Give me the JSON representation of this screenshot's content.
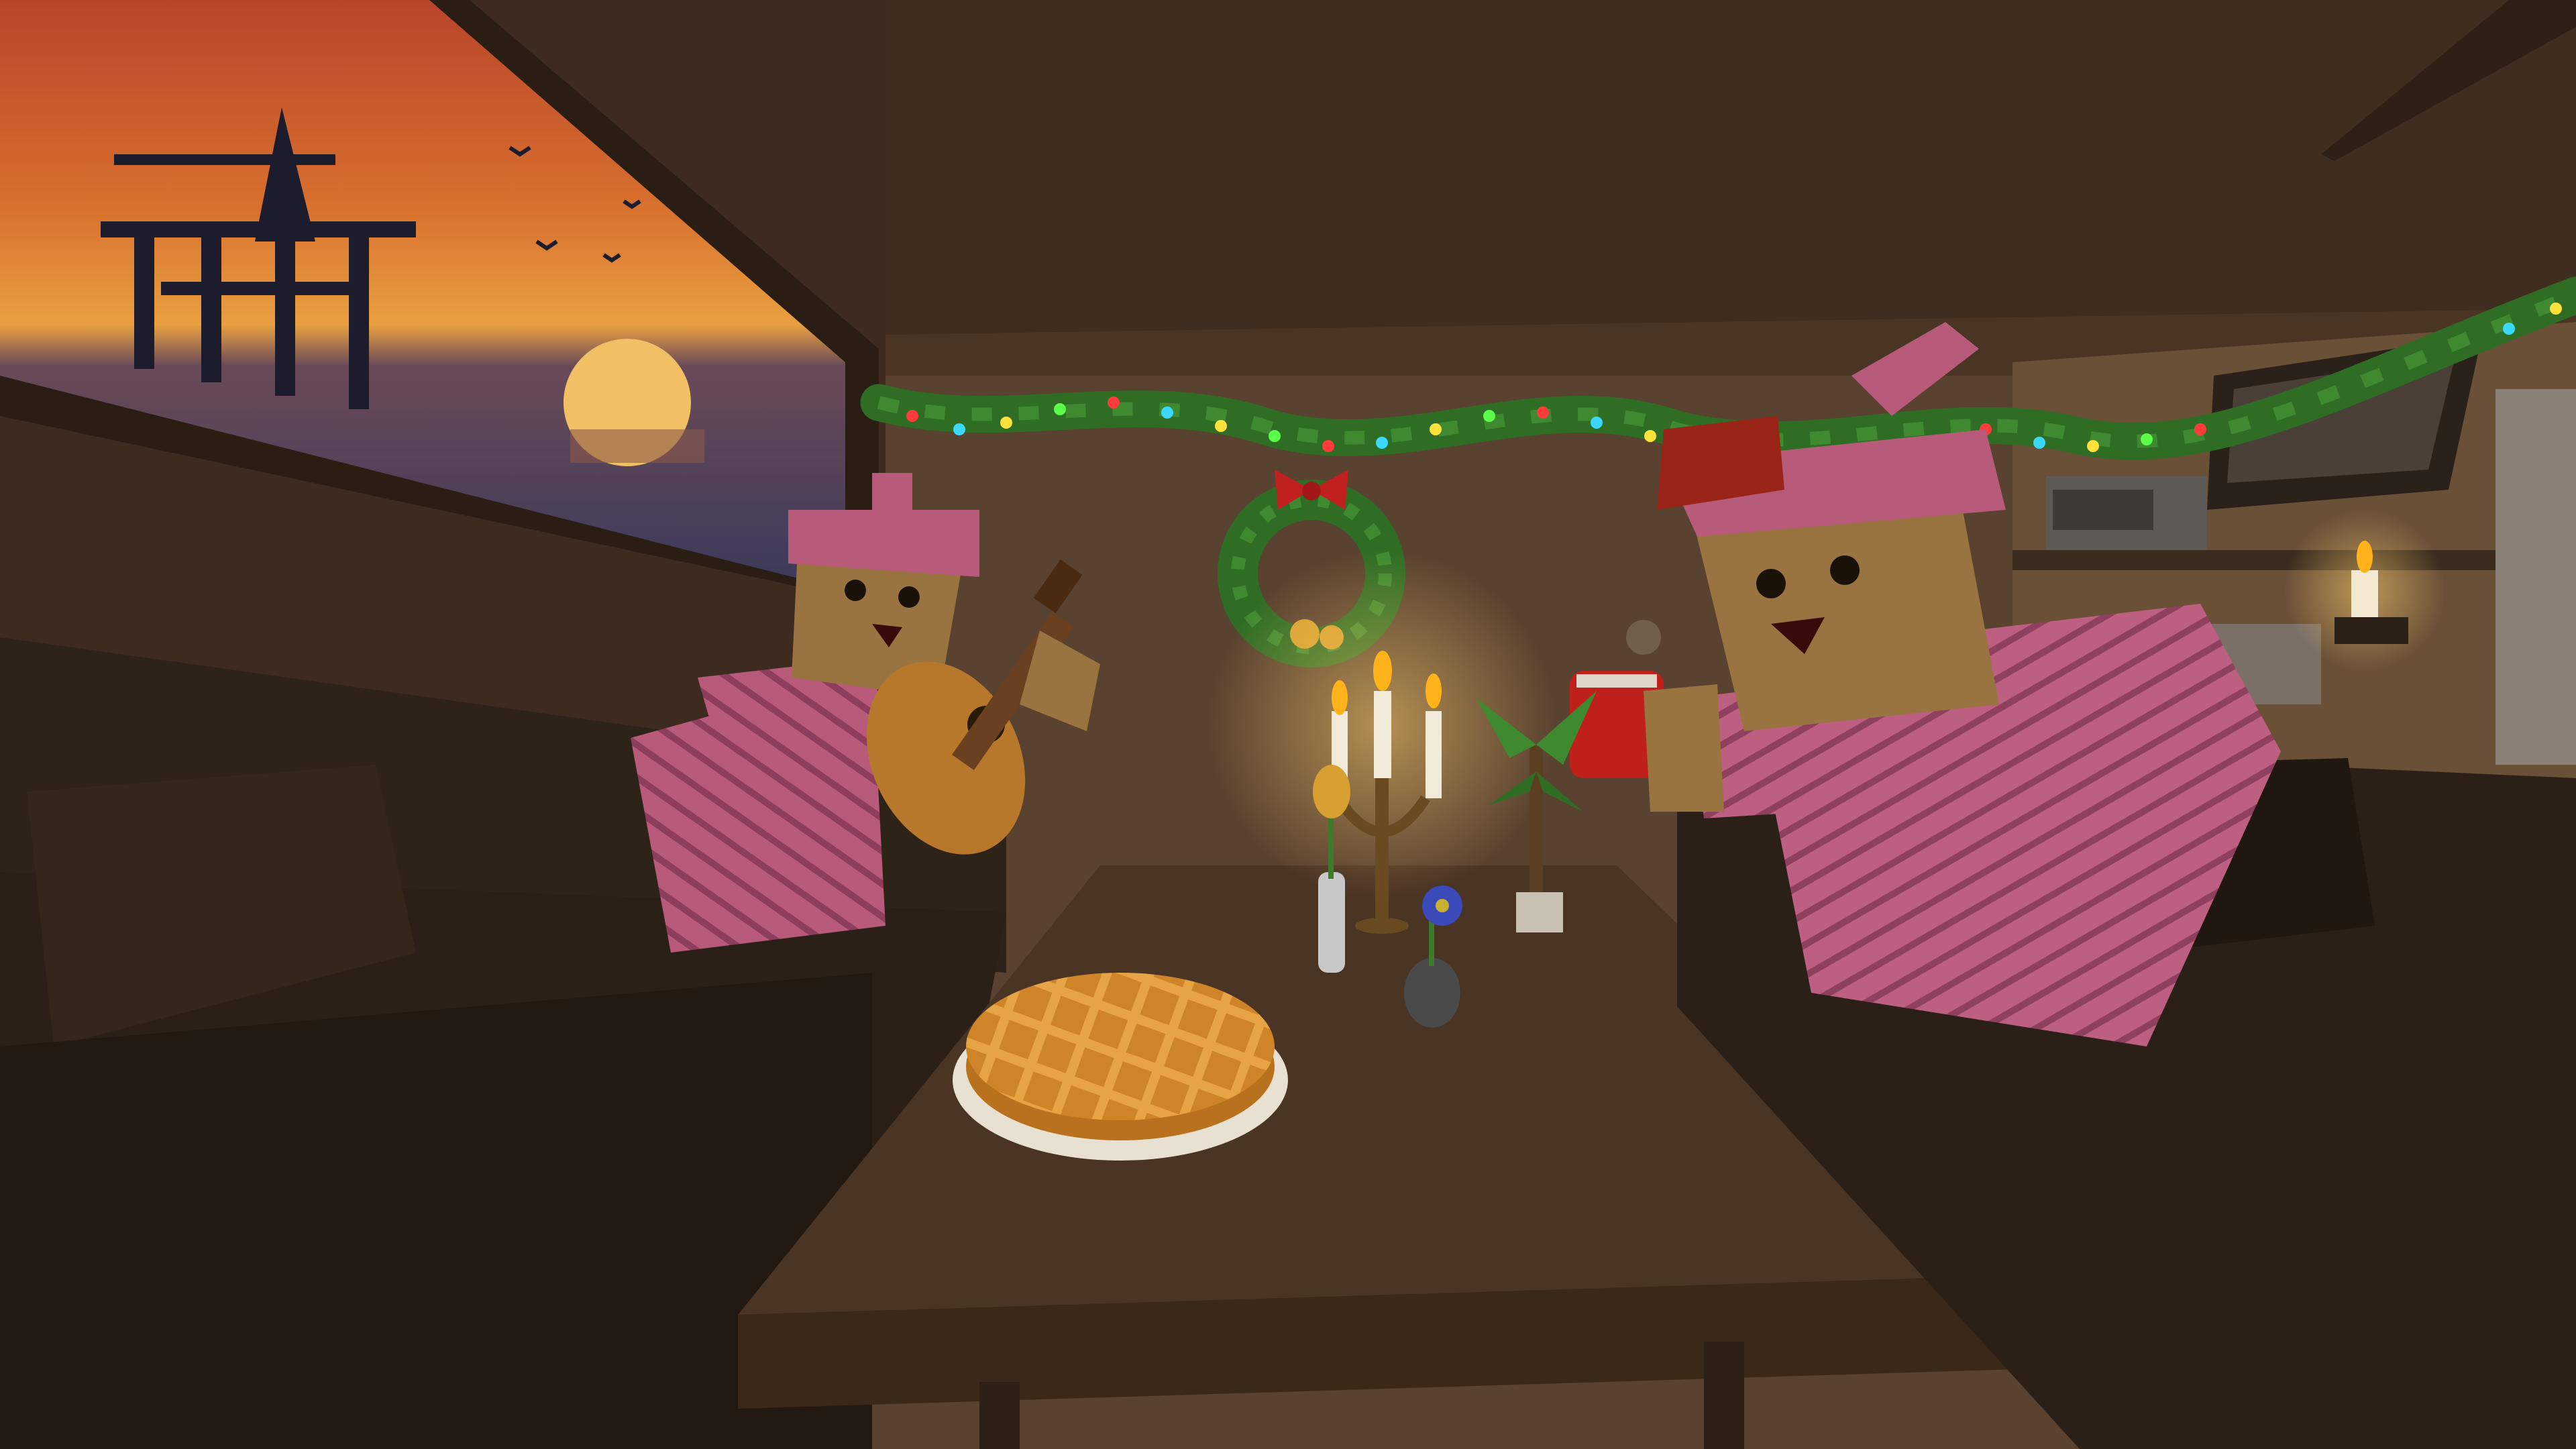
{
  "scene": {
    "setting": "cozy-cabin-interior",
    "season_decor": [
      "christmas-garland",
      "christmas-wreath",
      "candelabra",
      "candles"
    ],
    "characters": [
      {
        "role": "guitar-player",
        "hat": "pink-beanie",
        "sweater": "pink-sweater"
      },
      {
        "role": "mug-holder",
        "hat": "pink-beanie",
        "sweater": "pink-sweater",
        "held_item": "red-mug"
      }
    ],
    "table_items": [
      "pie",
      "candelabra",
      "tulip-vase",
      "blue-flower-vase"
    ],
    "wall_items": [
      "pixel-art-sunset-painting",
      "wreath",
      "candle-sconce",
      "tv"
    ]
  },
  "colors": {
    "wall": "#5a4230",
    "ceiling": "#3e2c1e",
    "table": "#4a3424",
    "sofa": "#2c2218",
    "sweater": "#b85a7a",
    "skin": "#9a7440",
    "garland": "#2f6d25",
    "candle_flame": "#ffb21a",
    "sunset_top": "#c9602a",
    "sunset_mid": "#e59a3a",
    "sea": "#3b3b58",
    "mug": "#c0201a",
    "pie": "#d8922c",
    "hat_red": "#9a2418"
  },
  "hud": {}
}
